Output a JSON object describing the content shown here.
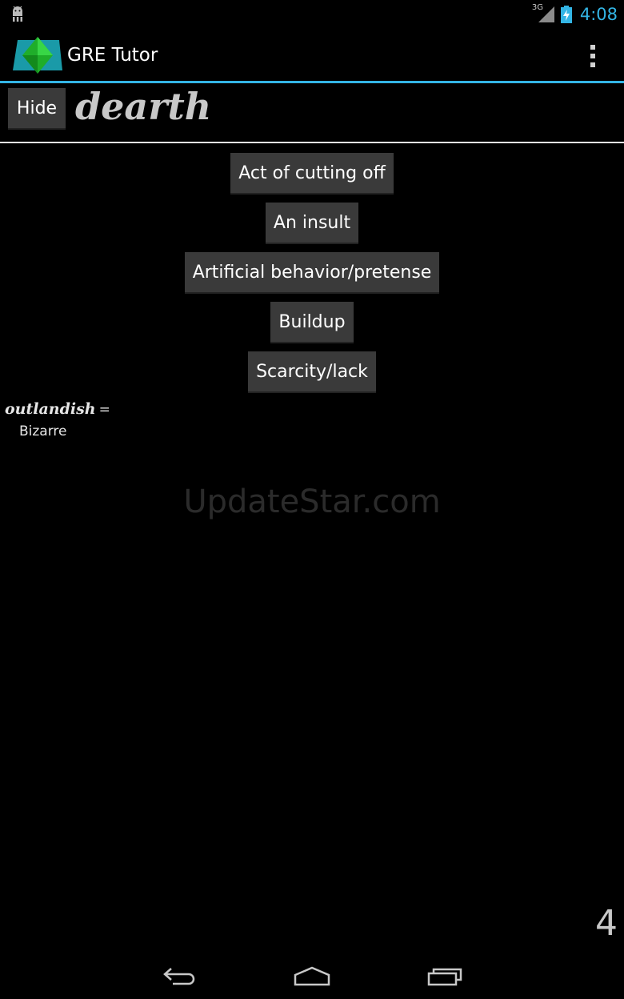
{
  "status_bar": {
    "network": "3G",
    "time": "4:08",
    "time_color": "#33b5e5"
  },
  "action_bar": {
    "title": "GRE Tutor",
    "accent_color": "#33b5e5"
  },
  "quiz": {
    "hide_label": "Hide",
    "word": "dearth",
    "choices": [
      {
        "label": "Act of cutting off"
      },
      {
        "label": "An insult"
      },
      {
        "label": "Artificial behavior/pretense"
      },
      {
        "label": "Buildup"
      },
      {
        "label": "Scarcity/lack"
      }
    ],
    "previous": {
      "word": "outlandish",
      "separator": "=",
      "meaning": "Bizarre"
    },
    "counter": "4"
  },
  "watermark": "UpdateStar.com",
  "icons": {
    "status_left": "android-debug-icon",
    "signal": "signal-icon",
    "battery": "battery-charging-icon",
    "menu": "overflow-menu-icon",
    "back": "back-icon",
    "home": "home-icon",
    "recents": "recents-icon"
  }
}
